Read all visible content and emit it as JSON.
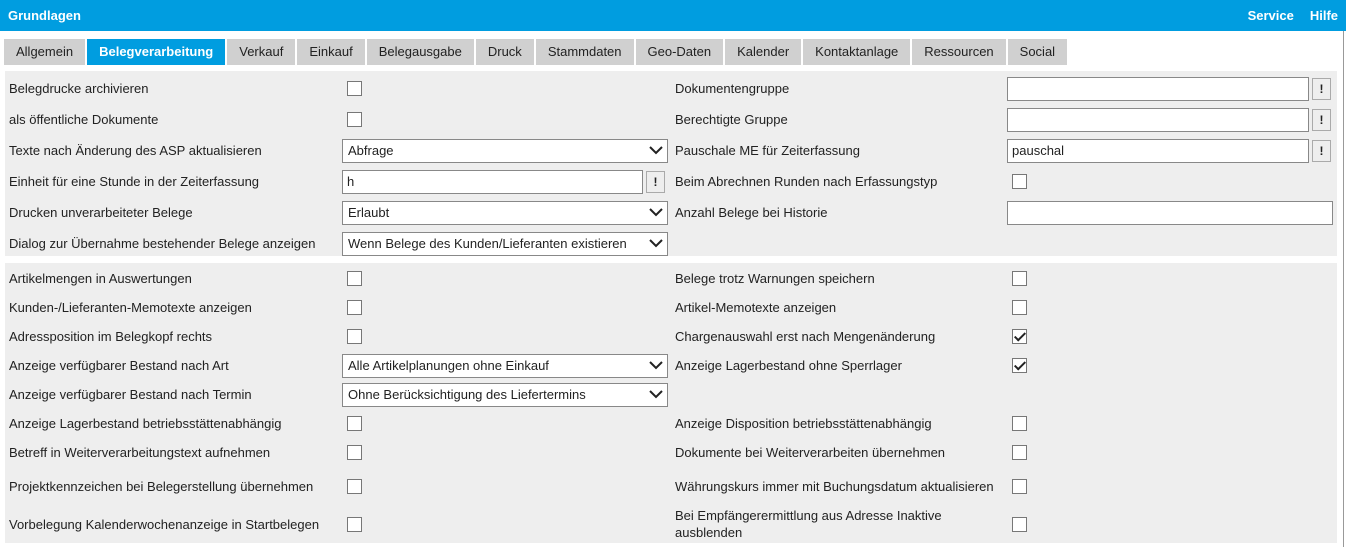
{
  "header": {
    "title": "Grundlagen",
    "links": [
      "Service",
      "Hilfe"
    ]
  },
  "tabs": [
    "Allgemein",
    "Belegverarbeitung",
    "Verkauf",
    "Einkauf",
    "Belegausgabe",
    "Druck",
    "Stammdaten",
    "Geo-Daten",
    "Kalender",
    "Kontaktanlage",
    "Ressourcen",
    "Social"
  ],
  "active_tab": "Belegverarbeitung",
  "sections": [
    {
      "rows": [
        {
          "h": 31,
          "left": {
            "label": "Belegdrucke archivieren",
            "type": "checkbox",
            "checked": false
          },
          "right": {
            "label": "Dokumentengruppe",
            "type": "input-ex",
            "value": ""
          }
        },
        {
          "h": 31,
          "left": {
            "label": "als öffentliche Dokumente",
            "type": "checkbox",
            "checked": false
          },
          "right": {
            "label": "Berechtigte Gruppe",
            "type": "input-ex",
            "value": ""
          }
        },
        {
          "h": 31,
          "left": {
            "label": "Texte nach Änderung des ASP aktualisieren",
            "type": "select",
            "value": "Abfrage"
          },
          "right": {
            "label": "Pauschale ME für Zeiterfassung",
            "type": "input-ex",
            "value": "pauschal"
          }
        },
        {
          "h": 31,
          "left": {
            "label": "Einheit für eine Stunde in der Zeiterfassung",
            "type": "input-ex",
            "value": "h"
          },
          "right": {
            "label": "Beim Abrechnen Runden nach Erfassungstyp",
            "type": "checkbox",
            "checked": false
          }
        },
        {
          "h": 31,
          "left": {
            "label": "Drucken unverarbeiteter Belege",
            "type": "select",
            "value": "Erlaubt"
          },
          "right": {
            "label": "Anzahl Belege bei Historie",
            "type": "input",
            "value": ""
          }
        },
        {
          "h": 31,
          "left": {
            "label": "Dialog zur Übernahme bestehender Belege anzeigen",
            "type": "select",
            "value": "Wenn Belege des Kunden/Lieferanten existieren"
          },
          "right": null
        }
      ]
    },
    {
      "rows": [
        {
          "h": 29,
          "left": {
            "label": "Artikelmengen in Auswertungen",
            "type": "checkbox",
            "checked": false
          },
          "right": {
            "label": "Belege trotz Warnungen speichern",
            "type": "checkbox",
            "checked": false
          }
        },
        {
          "h": 29,
          "left": {
            "label": "Kunden-/Lieferanten-Memotexte anzeigen",
            "type": "checkbox",
            "checked": false
          },
          "right": {
            "label": "Artikel-Memotexte anzeigen",
            "type": "checkbox",
            "checked": false
          }
        },
        {
          "h": 29,
          "left": {
            "label": "Adressposition im Belegkopf rechts",
            "type": "checkbox",
            "checked": false
          },
          "right": {
            "label": "Chargenauswahl erst nach Mengenänderung",
            "type": "checkbox",
            "checked": true
          }
        },
        {
          "h": 29,
          "left": {
            "label": "Anzeige verfügbarer Bestand nach Art",
            "type": "select",
            "value": "Alle Artikelplanungen ohne Einkauf"
          },
          "right": {
            "label": "Anzeige Lagerbestand ohne Sperrlager",
            "type": "checkbox",
            "checked": true
          }
        },
        {
          "h": 29,
          "left": {
            "label": "Anzeige verfügbarer Bestand nach Termin",
            "type": "select",
            "value": "Ohne Berücksichtigung des Liefertermins"
          },
          "right": null
        },
        {
          "h": 29,
          "left": {
            "label": "Anzeige Lagerbestand betriebsstättenabhängig",
            "type": "checkbox",
            "checked": false
          },
          "right": {
            "label": "Anzeige Disposition betriebsstättenabhängig",
            "type": "checkbox",
            "checked": false
          }
        },
        {
          "h": 29,
          "left": {
            "label": "Betreff in Weiterverarbeitungstext aufnehmen",
            "type": "checkbox",
            "checked": false
          },
          "right": {
            "label": "Dokumente bei Weiterverarbeiten übernehmen",
            "type": "checkbox",
            "checked": false
          }
        },
        {
          "h": 38,
          "left": {
            "label": "Projektkennzeichen bei Belegerstellung übernehmen",
            "type": "checkbox",
            "checked": false
          },
          "right": {
            "label": "Währungskurs immer mit Buchungsdatum aktualisieren",
            "type": "checkbox",
            "checked": false
          }
        },
        {
          "h": 38,
          "left": {
            "label": "Vorbelegung Kalenderwochenanzeige in Startbelegen",
            "type": "checkbox",
            "checked": false
          },
          "right": {
            "label": "Bei Empfängerermittlung aus Adresse Inaktive ausblenden",
            "type": "checkbox",
            "checked": false
          }
        }
      ]
    }
  ],
  "ex_button_label": "!"
}
